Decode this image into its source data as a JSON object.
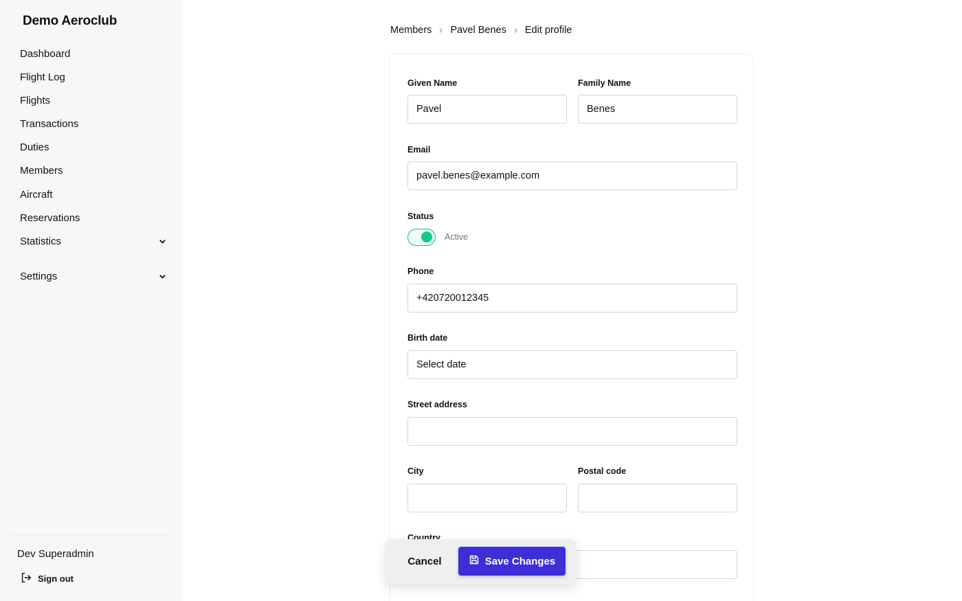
{
  "app": {
    "title": "Demo Aeroclub"
  },
  "sidebar": {
    "items": [
      {
        "label": "Dashboard"
      },
      {
        "label": "Flight Log"
      },
      {
        "label": "Flights"
      },
      {
        "label": "Transactions"
      },
      {
        "label": "Duties"
      },
      {
        "label": "Members"
      },
      {
        "label": "Aircraft"
      },
      {
        "label": "Reservations"
      },
      {
        "label": "Statistics",
        "expandable": true
      },
      {
        "label": "Settings",
        "expandable": true
      }
    ],
    "user": {
      "name": "Dev Superadmin",
      "signout_label": "Sign out"
    }
  },
  "breadcrumb": [
    "Members",
    "Pavel Benes",
    "Edit profile"
  ],
  "form": {
    "given_name": {
      "label": "Given Name",
      "value": "Pavel"
    },
    "family_name": {
      "label": "Family Name",
      "value": "Benes"
    },
    "email": {
      "label": "Email",
      "value": "pavel.benes@example.com"
    },
    "status": {
      "label": "Status",
      "value_label": "Active",
      "on": true
    },
    "phone": {
      "label": "Phone",
      "value": "+420720012345"
    },
    "birth_date": {
      "label": "Birth date",
      "placeholder": "Select date"
    },
    "street": {
      "label": "Street address",
      "value": ""
    },
    "city": {
      "label": "City",
      "value": ""
    },
    "postal_code": {
      "label": "Postal code",
      "value": ""
    },
    "country": {
      "label": "Country",
      "value": ""
    }
  },
  "actions": {
    "cancel_label": "Cancel",
    "save_label": "Save Changes"
  },
  "colors": {
    "accent": "#3d2ed6",
    "toggle_on": "#10c98a",
    "sidebar_bg": "#f7f7f7"
  },
  "icons": {
    "chevron": "chevron-down-icon",
    "breadcrumb_sep": "chevron-right-icon",
    "signout": "sign-out-icon",
    "save": "save-icon"
  }
}
